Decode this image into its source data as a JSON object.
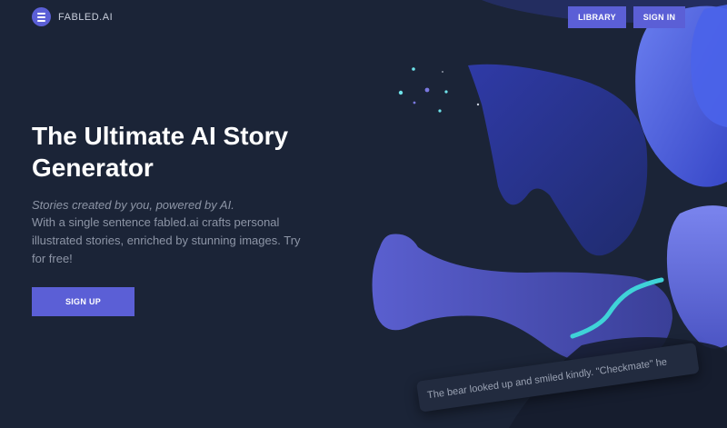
{
  "header": {
    "brand": "FABLED.AI",
    "library_label": "LIBRARY",
    "signin_label": "SIGN IN"
  },
  "hero": {
    "title": "The Ultimate AI Story Generator",
    "tagline": "Stories created by you, powered by AI.",
    "description": "With a single sentence fabled.ai crafts personal illustrated stories, enriched by stunning images. Try for free!",
    "cta_label": "SIGN UP"
  },
  "illustration": {
    "story_snippet": "The bear looked up and smiled kindly. \"Checkmate\" he"
  },
  "colors": {
    "background": "#1b2437",
    "accent": "#5b5fd6",
    "swirl": "#3fd3d8"
  }
}
